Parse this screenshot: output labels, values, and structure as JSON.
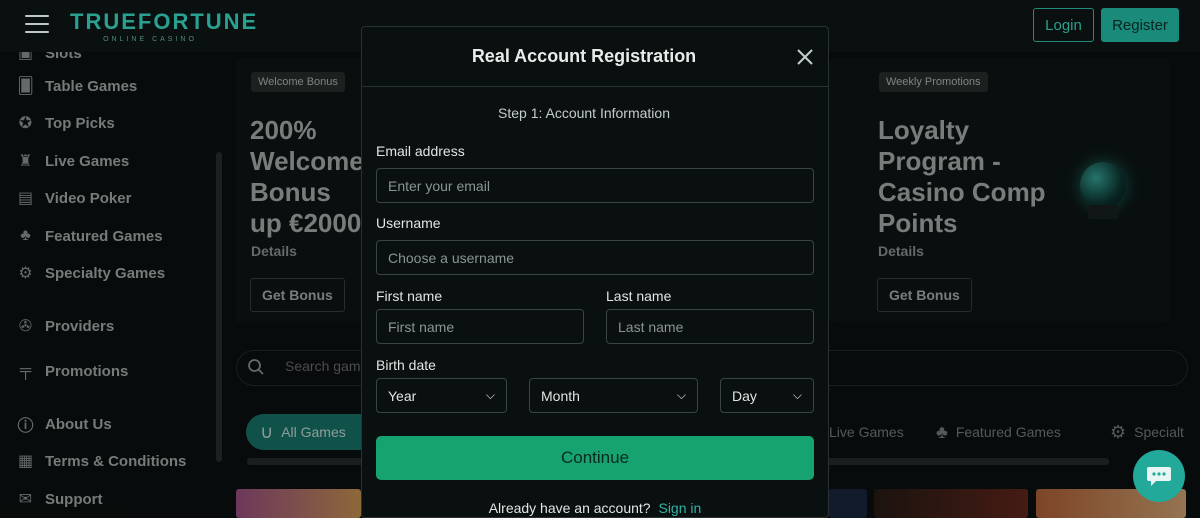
{
  "header": {
    "logo_main": "TRUEFORTUNE",
    "logo_sub": "ONLINE CASINO",
    "login_label": "Login",
    "register_label": "Register"
  },
  "sidebar": {
    "items": [
      {
        "label": "Slots",
        "icon": "slot-icon"
      },
      {
        "label": "Table Games",
        "icon": "cards-icon"
      },
      {
        "label": "Top Picks",
        "icon": "award-icon"
      },
      {
        "label": "Live Games",
        "icon": "live-icon"
      },
      {
        "label": "Video Poker",
        "icon": "video-poker-icon"
      },
      {
        "label": "Featured Games",
        "icon": "clover-icon"
      },
      {
        "label": "Specialty Games",
        "icon": "gear-icon"
      },
      {
        "label": "Providers",
        "icon": "providers-icon"
      },
      {
        "label": "Promotions",
        "icon": "gift-icon"
      },
      {
        "label": "About Us",
        "icon": "info-icon"
      },
      {
        "label": "Terms & Conditions",
        "icon": "document-icon"
      },
      {
        "label": "Support",
        "icon": "mail-icon"
      }
    ]
  },
  "banners": [
    {
      "tag": "Welcome Bonus",
      "title": "200% Welcome Bonus up €2000",
      "details": "Details",
      "button": "Get Bonus"
    },
    {
      "tag": "Weekly Promotions",
      "title": "Loyalty Program - Casino Comp Points",
      "details": "Details",
      "button": "Get Bonus"
    }
  ],
  "search": {
    "placeholder": "Search gam"
  },
  "categories": [
    {
      "label": "All Games",
      "icon": "horseshoe-icon"
    },
    {
      "label": "Live Games",
      "icon": ""
    },
    {
      "label": "Featured Games",
      "icon": "clover-icon"
    },
    {
      "label": "Specialt",
      "icon": "gear-icon"
    }
  ],
  "modal": {
    "title": "Real Account Registration",
    "step": "Step 1: Account Information",
    "email_label": "Email address",
    "email_placeholder": "Enter your email",
    "username_label": "Username",
    "username_placeholder": "Choose a username",
    "first_name_label": "First name",
    "first_name_placeholder": "First name",
    "last_name_label": "Last name",
    "last_name_placeholder": "Last name",
    "birth_label": "Birth date",
    "year": "Year",
    "month": "Month",
    "day": "Day",
    "continue_label": "Continue",
    "have_account": "Already have an account?",
    "sign_in": "Sign in"
  },
  "colors": {
    "accent": "#1a8a7a",
    "continue_button": "#16a36f",
    "link": "#2cb5a4"
  }
}
